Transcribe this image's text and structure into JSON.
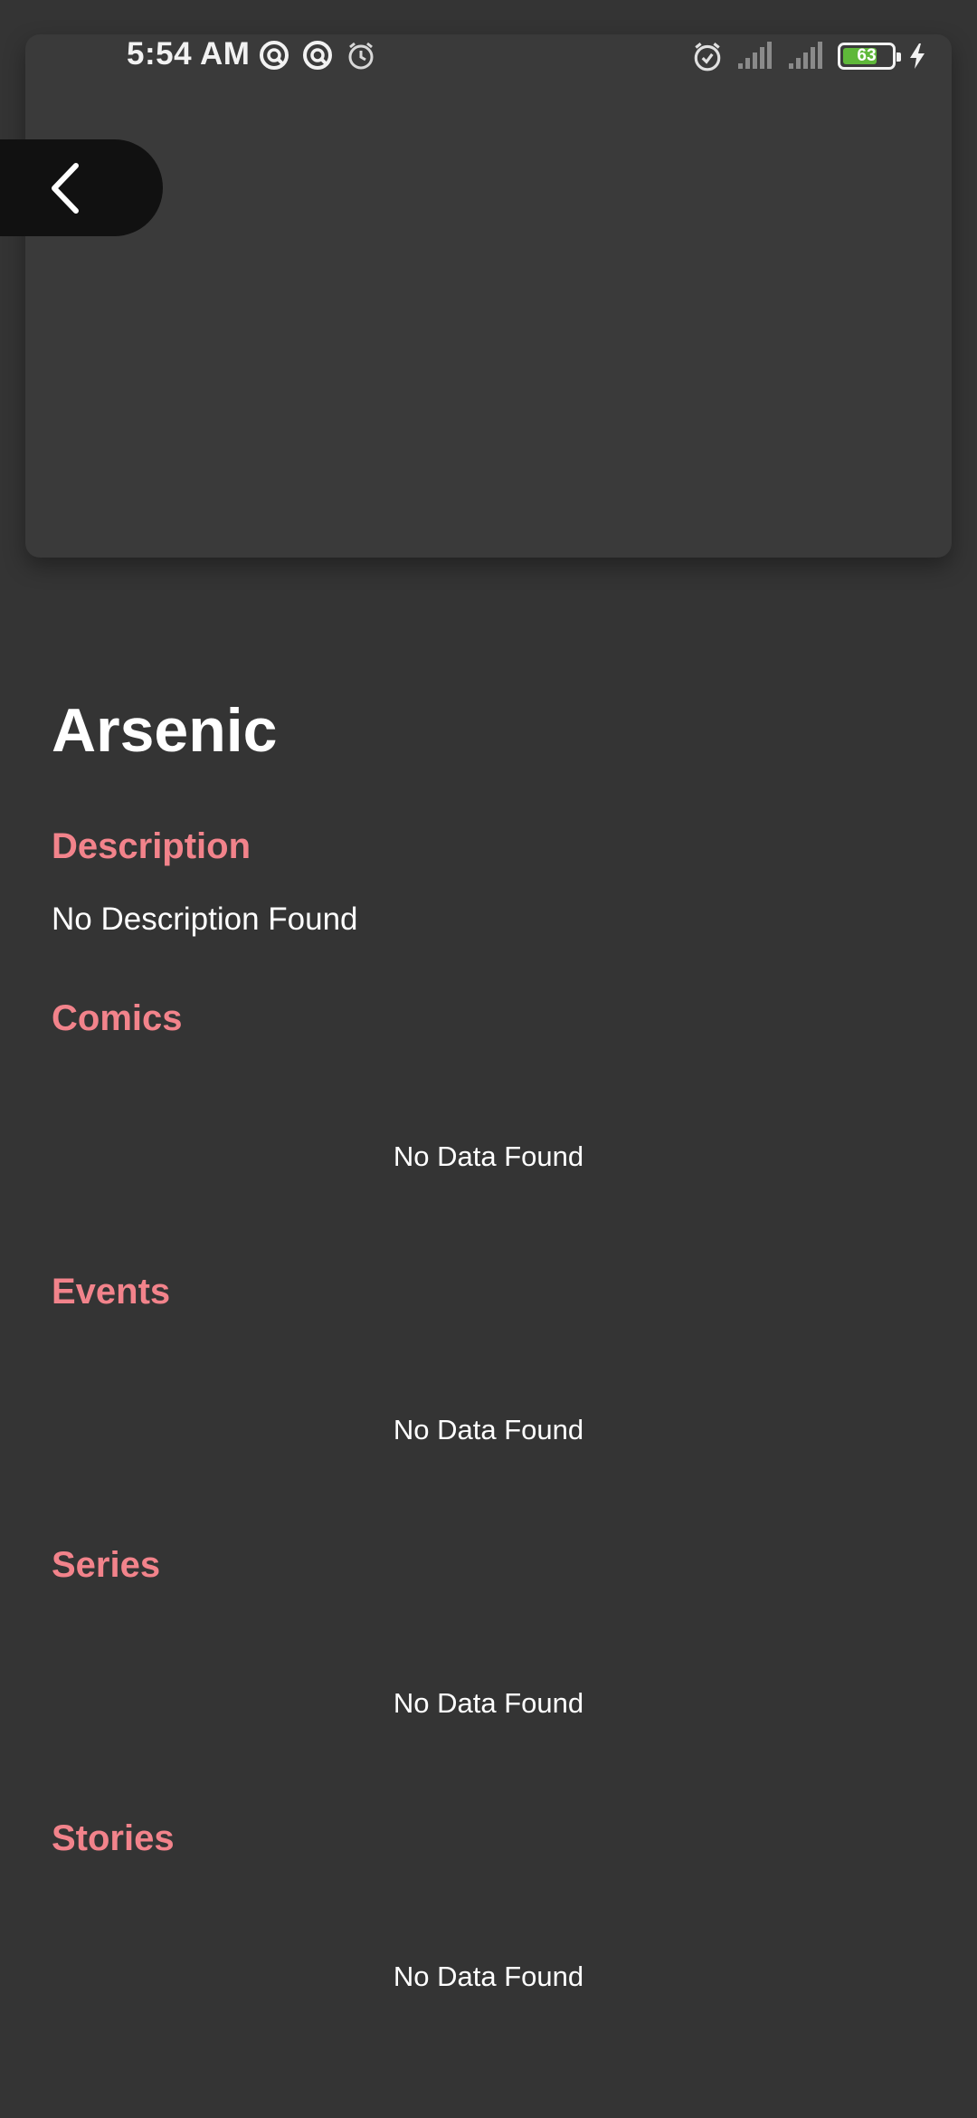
{
  "status_bar": {
    "time": "5:54 AM",
    "battery_level": "63",
    "left_icons": [
      "sync-icon",
      "sync-icon",
      "alarm-icon"
    ],
    "right_icons": [
      "alarm-icon",
      "signal-icon",
      "signal-icon",
      "battery-icon",
      "charging-icon"
    ]
  },
  "header": {
    "back_icon": "chevron-left-icon"
  },
  "character": {
    "name": "Arsenic"
  },
  "sections": {
    "description": {
      "title": "Description",
      "text": "No Description Found"
    },
    "comics": {
      "title": "Comics",
      "empty": "No Data Found"
    },
    "events": {
      "title": "Events",
      "empty": "No Data Found"
    },
    "series": {
      "title": "Series",
      "empty": "No Data Found"
    },
    "stories": {
      "title": "Stories",
      "empty": "No Data Found"
    }
  },
  "colors": {
    "background": "#343434",
    "hero_card": "#3a3a3a",
    "accent": "#f2838b",
    "back_button": "#111111",
    "text": "#ffffff"
  }
}
